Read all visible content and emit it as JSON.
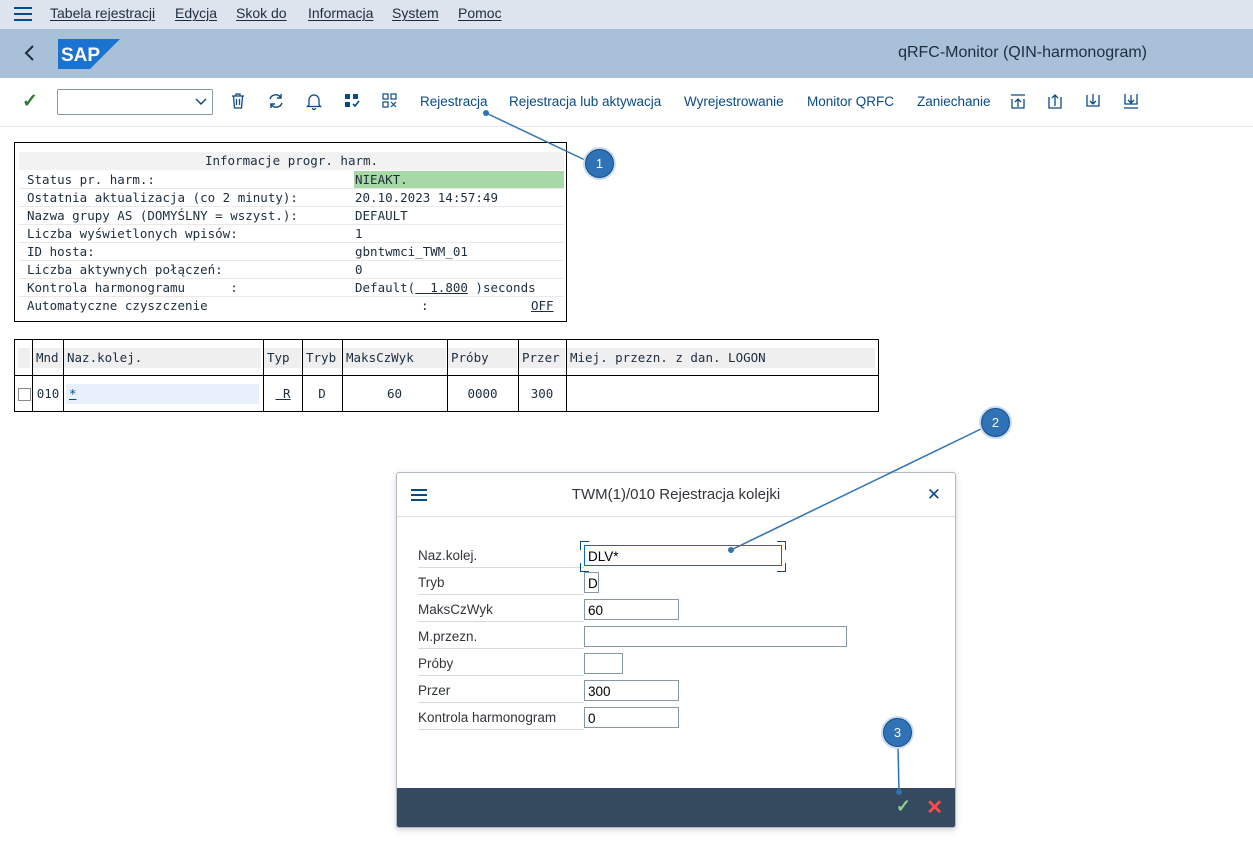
{
  "menubar": {
    "items": [
      "Tabela rejestracji",
      "Edycja",
      "Skok do",
      "Informacja",
      "System",
      "Pomoc"
    ]
  },
  "shell": {
    "logo": "SAP",
    "title": "qRFC-Monitor (QIN-harmonogram)"
  },
  "toolbar": {
    "buttons": [
      "Rejestracja",
      "Rejestracja lub aktywacja",
      "Wyrejestrowanie",
      "Monitor QRFC",
      "Zaniechanie"
    ]
  },
  "info": {
    "header": "Informacje progr. harm.",
    "rows": [
      {
        "label": "Status pr. harm.:",
        "value": "NIEAKT."
      },
      {
        "label": "Ostatnia aktualizacja (co 2 minuty):",
        "value": "20.10.2023 14:57:49"
      },
      {
        "label": "Nazwa grupy AS (DOMYŚLNY = wszyst.):",
        "value": "DEFAULT"
      },
      {
        "label": "Liczba wyświetlonych wpisów:",
        "value": "1"
      },
      {
        "label": "ID hosta:",
        "value": "gbntwmci_TWM_01"
      },
      {
        "label": "Liczba aktywnych połączeń:",
        "value": "0"
      },
      {
        "label": "Kontrola harmonogramu      :",
        "value_prefix": "Default(",
        "value_num": "  1.800",
        "value_suffix": " )seconds"
      },
      {
        "label": "Automatyczne czyszczenie",
        "value_colon": ":",
        "value": "OFF"
      }
    ]
  },
  "queue_table": {
    "columns": [
      "Mnd",
      "Naz.kolej.",
      "Typ",
      "Tryb",
      "MaksCzWyk",
      "Próby",
      "Przer",
      "Miej. przezn. z dan. LOGON"
    ],
    "rows": [
      {
        "mnd": "010",
        "name": "*",
        "typ": " R",
        "tryb": "D",
        "maks": "60",
        "proby": "0000",
        "przer": "300",
        "dest": ""
      }
    ]
  },
  "dialog": {
    "title": "TWM(1)/010 Rejestracja kolejki",
    "fields": [
      {
        "label": "Naz.kolej.",
        "value": "DLV*"
      },
      {
        "label": "Tryb",
        "value": "D"
      },
      {
        "label": "MaksCzWyk",
        "value": "60"
      },
      {
        "label": "M.przezn.",
        "value": ""
      },
      {
        "label": "Próby",
        "value": ""
      },
      {
        "label": "Przer",
        "value": "300"
      },
      {
        "label": "Kontrola harmonogram",
        "value": "0"
      }
    ]
  },
  "callouts": [
    "1",
    "2",
    "3"
  ],
  "colors": {
    "menubar": "#dde4ed",
    "shellbar": "#a9c0d9",
    "status_green": "#a6d9a6",
    "dialog_footer": "#354a5f",
    "callout": "#2f72b5"
  }
}
